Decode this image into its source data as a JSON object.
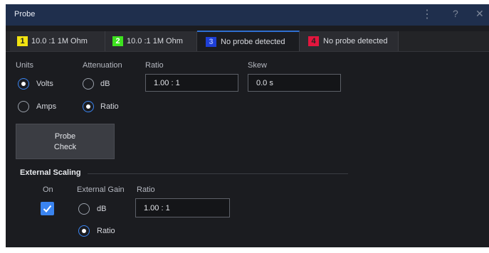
{
  "window": {
    "title": "Probe",
    "menu_icon": "kebab-icon",
    "help_label": "?",
    "close_icon": "close-icon"
  },
  "tabs": [
    {
      "number": "1",
      "label": "10.0 :1 1M Ohm",
      "color": "#f2e311",
      "active": false
    },
    {
      "number": "2",
      "label": "10.0 :1 1M Ohm",
      "color": "#3de21f",
      "active": false
    },
    {
      "number": "3",
      "label": "No probe detected",
      "color": "#1e3fd6",
      "active": true
    },
    {
      "number": "4",
      "label": "No probe detected",
      "color": "#e3163e",
      "active": false
    }
  ],
  "units": {
    "label": "Units",
    "options": [
      "Volts",
      "Amps"
    ],
    "selected": "Volts"
  },
  "attenuation": {
    "label": "Attenuation",
    "options": [
      "dB",
      "Ratio"
    ],
    "selected": "Ratio"
  },
  "ratio": {
    "label": "Ratio",
    "value": "1.00 : 1"
  },
  "skew": {
    "label": "Skew",
    "value": "0.0 s"
  },
  "probe_check": {
    "line1": "Probe",
    "line2": "Check"
  },
  "external_scaling": {
    "title": "External Scaling",
    "on_label": "On",
    "on_checked": true,
    "gain_label": "External Gain",
    "gain_options": [
      "dB",
      "Ratio"
    ],
    "gain_selected": "Ratio",
    "ratio_label": "Ratio",
    "ratio_value": "1.00 : 1"
  },
  "colors": {
    "accent": "#3a84f0",
    "titlebar": "#1f2f4d",
    "background": "#1b1c20"
  }
}
